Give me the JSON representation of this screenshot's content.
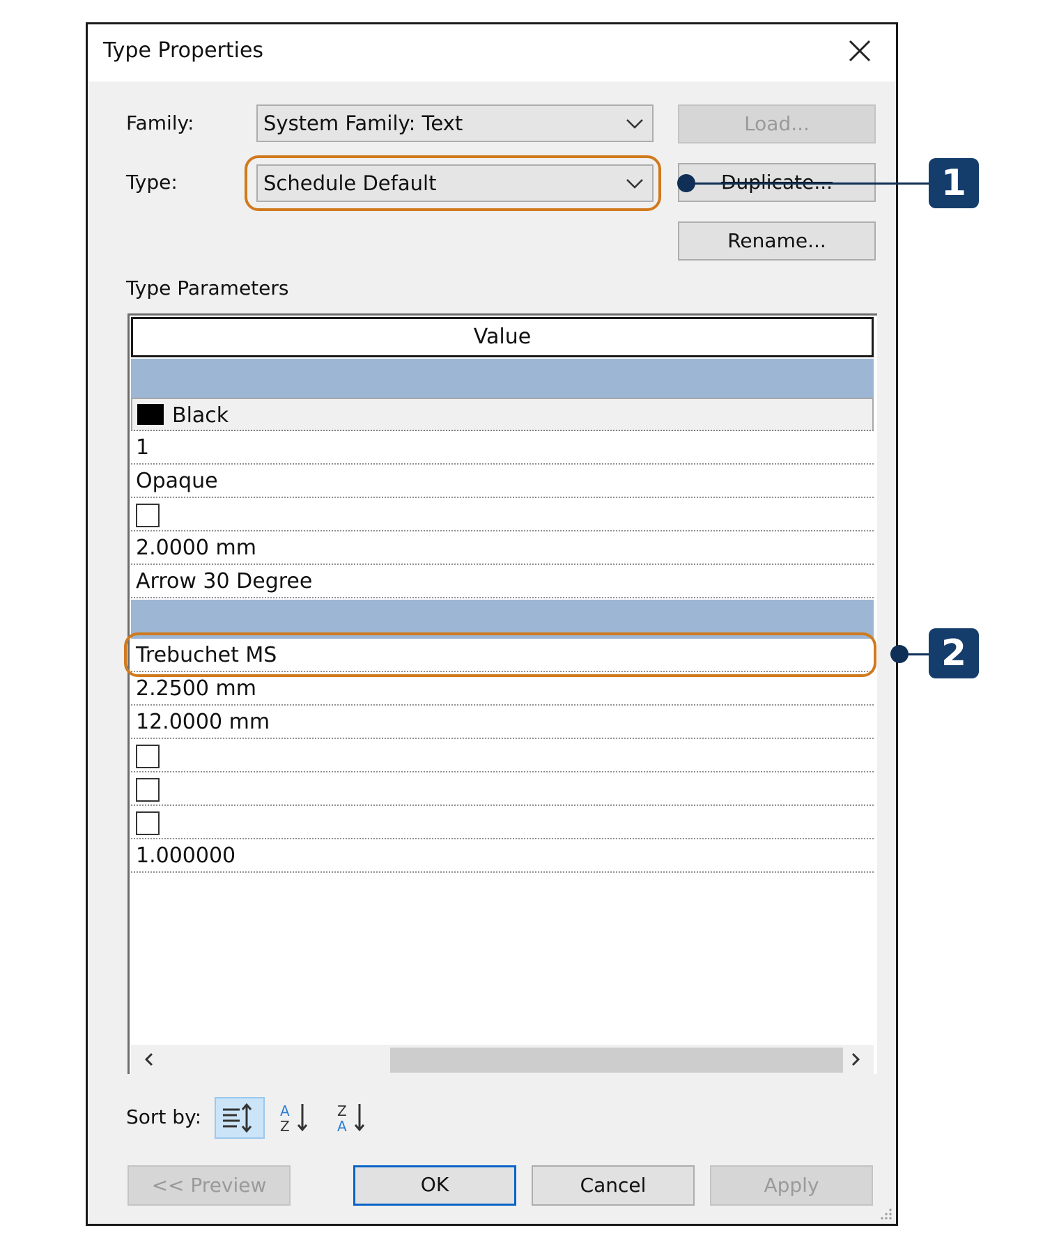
{
  "dialog": {
    "title": "Type Properties",
    "family_label": "Family:",
    "family_value": "System Family: Text",
    "type_label": "Type:",
    "type_value": "Schedule Default",
    "load_button": "Load...",
    "duplicate_button": "Duplicate...",
    "rename_button": "Rename...",
    "section_label": "Type Parameters",
    "grid_header": "Value",
    "rows_group1": [
      {
        "kind": "color",
        "text": "Black",
        "swatch": "#000000"
      },
      {
        "kind": "text",
        "text": "1"
      },
      {
        "kind": "text",
        "text": "Opaque"
      },
      {
        "kind": "checkbox",
        "checked": false
      },
      {
        "kind": "text",
        "text": "2.0000 mm"
      },
      {
        "kind": "text",
        "text": "Arrow 30 Degree"
      }
    ],
    "rows_group2": [
      {
        "kind": "text",
        "text": "Trebuchet MS"
      },
      {
        "kind": "text",
        "text": "2.2500 mm"
      },
      {
        "kind": "text",
        "text": "12.0000 mm"
      },
      {
        "kind": "checkbox",
        "checked": false
      },
      {
        "kind": "checkbox",
        "checked": false
      },
      {
        "kind": "checkbox",
        "checked": false
      },
      {
        "kind": "text",
        "text": "1.000000"
      }
    ],
    "sort_label": "Sort by:",
    "preview_button": "<< Preview",
    "ok_button": "OK",
    "cancel_button": "Cancel",
    "apply_button": "Apply"
  },
  "callouts": [
    {
      "number": "1"
    },
    {
      "number": "2"
    }
  ],
  "colors": {
    "group_header": "#9cb6d4",
    "callout_outline": "#d07a1e",
    "callout_badge": "#143d6b",
    "ok_border": "#0a64c8"
  }
}
